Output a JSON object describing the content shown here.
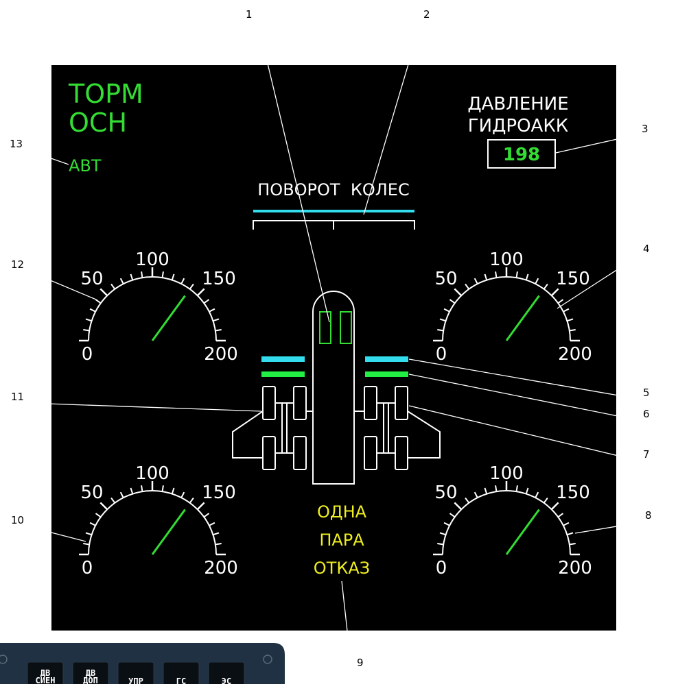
{
  "colors": {
    "screen": "#000000",
    "white": "#ffffff",
    "green": "#33dd33",
    "bright_green": "#22ee44",
    "cyan": "#33ddee",
    "yellow": "#eeee22",
    "callout": "#ffffff",
    "panel": "#1f3142"
  },
  "title": {
    "line1": "ТОРМ",
    "line2": "ОСН"
  },
  "auto_mode": "АВТ",
  "pressure": {
    "line1": "ДАВЛЕНИЕ",
    "line2": "ГИДРОАКК",
    "value": "198"
  },
  "steering": {
    "label": "ПОВОРОТ  КОЛЕС"
  },
  "gauge_scale": {
    "min": 0,
    "max": 200,
    "labels": [
      "0",
      "50",
      "100",
      "150",
      "200"
    ]
  },
  "gauges": [
    {
      "name": "top-left",
      "value": 140
    },
    {
      "name": "top-right",
      "value": 140
    },
    {
      "name": "bottom-left",
      "value": 140
    },
    {
      "name": "bottom-right",
      "value": 140
    }
  ],
  "failure_message": {
    "line1": "ОДНА",
    "line2": "ПАРА",
    "line3": "ОТКАЗ"
  },
  "callouts": [
    "1",
    "2",
    "3",
    "4",
    "5",
    "6",
    "7",
    "8",
    "9",
    "10",
    "11",
    "12",
    "13"
  ],
  "panel_buttons": [
    {
      "line1": "ДВ",
      "line2": "СИЕН"
    },
    {
      "line1": "ДВ",
      "line2": "ДОП"
    },
    {
      "line1": "УПР",
      "line2": ""
    },
    {
      "line1": "ГС",
      "line2": ""
    },
    {
      "line1": "ЭС",
      "line2": ""
    }
  ]
}
